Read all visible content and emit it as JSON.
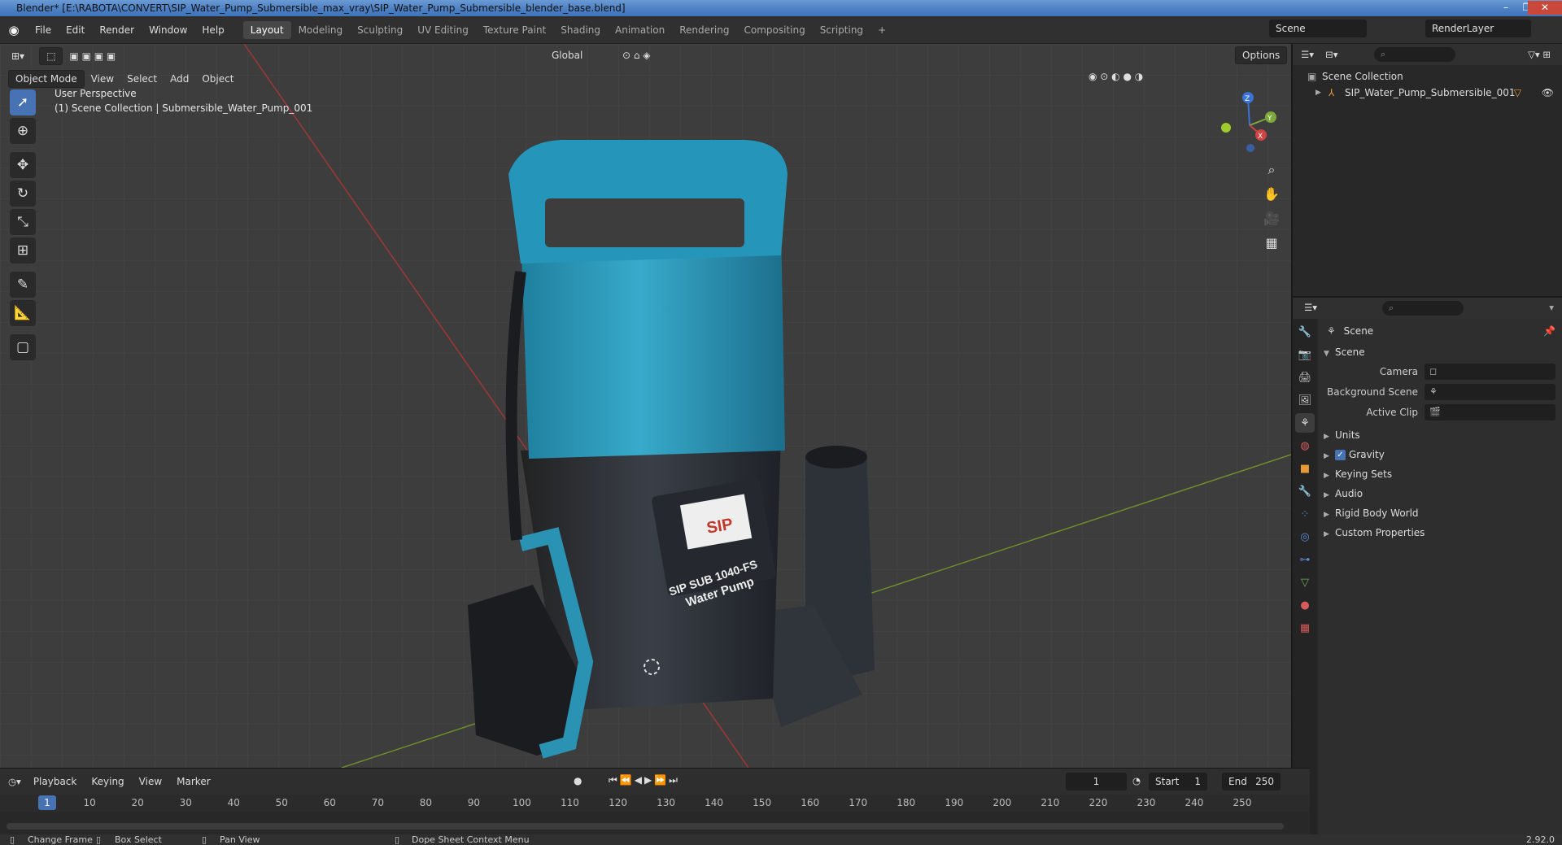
{
  "window": {
    "title": "Blender* [E:\\RABOTA\\CONVERT\\SIP_Water_Pump_Submersible_max_vray\\SIP_Water_Pump_Submersible_blender_base.blend]",
    "minimize": "–",
    "maximize": "❐",
    "close": "✕"
  },
  "menubar": {
    "items": [
      "File",
      "Edit",
      "Render",
      "Window",
      "Help"
    ]
  },
  "workspaces": [
    "Layout",
    "Modeling",
    "Sculpting",
    "UV Editing",
    "Texture Paint",
    "Shading",
    "Animation",
    "Rendering",
    "Compositing",
    "Scripting"
  ],
  "add_workspace": "+",
  "scene_field": "Scene",
  "renderlayer_field": "RenderLayer",
  "viewport": {
    "mode": "Object Mode",
    "menus": [
      "View",
      "Select",
      "Add",
      "Object"
    ],
    "transform_orientation": "Global",
    "options": "Options",
    "info_line1": "User Perspective",
    "info_line2": "(1) Scene Collection | Submersible_Water_Pump_001",
    "axis_x": "X",
    "axis_y": "Y",
    "axis_z": "Z",
    "label_brand": "SIP",
    "label_model": "SIP SUB 1040-FS",
    "label_name": "Water Pump"
  },
  "timeline": {
    "menus": [
      "Playback",
      "Keying",
      "View",
      "Marker"
    ],
    "current_frame": "1",
    "start_label": "Start",
    "start": "1",
    "end_label": "End",
    "end": "250",
    "ticks": [
      "1",
      "10",
      "20",
      "30",
      "40",
      "50",
      "60",
      "70",
      "80",
      "90",
      "100",
      "110",
      "120",
      "130",
      "140",
      "150",
      "160",
      "170",
      "180",
      "190",
      "200",
      "210",
      "220",
      "230",
      "240",
      "250"
    ]
  },
  "outliner": {
    "root": "Scene Collection",
    "object": "SIP_Water_Pump_Submersible_001"
  },
  "properties": {
    "context": "Scene",
    "panel_title": "Scene",
    "camera_label": "Camera",
    "background_scene_label": "Background Scene",
    "active_clip_label": "Active Clip",
    "sections": [
      "Units",
      "Gravity",
      "Keying Sets",
      "Audio",
      "Rigid Body World",
      "Custom Properties"
    ]
  },
  "statusbar": {
    "change_frame": "Change Frame",
    "box_select": "Box Select",
    "pan_view": "Pan View",
    "context_menu": "Dope Sheet Context Menu",
    "version": "2.92.0"
  },
  "colors": {
    "accent": "#4772b3",
    "pump_blue": "#2a93b4",
    "pump_dark": "#2b2f36"
  }
}
